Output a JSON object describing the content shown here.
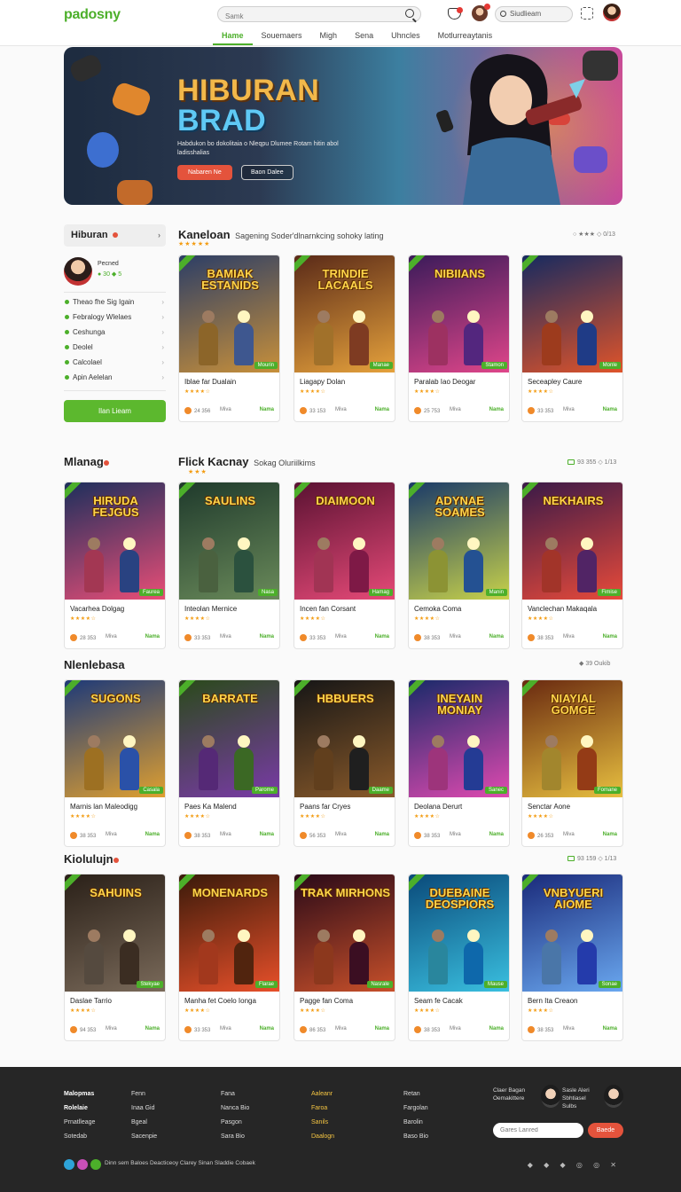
{
  "header": {
    "logo": "padosny",
    "search_placeholder": "Samk",
    "search2_placeholder": "Siudlieam",
    "nav": [
      "Hame",
      "Souemaers",
      "Migh",
      "Sena",
      "Uhncles",
      "Motlurreaytanis"
    ],
    "nav_active_index": 0,
    "colors": {
      "accent": "#4caf2a",
      "badge": "#e53935"
    }
  },
  "hero": {
    "title_line1": "HIBURAN",
    "title_line2": "BRAD",
    "subtitle": "Habdukon bo dokolitaia o Nleqpu Dlumee Rotam hitin abol ladisshalias",
    "primary_button": "Nabaren Ne",
    "secondary_button": "Baon Dalee"
  },
  "sidebar": {
    "title": "Hiburan",
    "profile_name": "Pecned",
    "profile_meta": "● 30 ◆ 5",
    "items": [
      {
        "label": "Theao fhe Sig Igain"
      },
      {
        "label": "Febralogy Wlelaes"
      },
      {
        "label": "Ceshunga"
      },
      {
        "label": "Deolel"
      },
      {
        "label": "Calcolael"
      },
      {
        "label": "Apin Aelelan"
      }
    ],
    "button": "Ilan Lieam"
  },
  "sections": [
    {
      "title": "Kaneloan",
      "subtitle": "Sagening Soder'dlnarnkcing sohoky lating",
      "meta": "○ ★★★ ◇ 0/13",
      "cards": [
        {
          "art_title": "BAMIAK ESTANIDS",
          "title": "Iblae far Dualain",
          "rating": "★★★★☆",
          "coins": "24 356",
          "mid": "Miva",
          "play": "Nama",
          "tag": "Mourin"
        },
        {
          "art_title": "TRINDIE LACAALS",
          "title": "Liagapy Dolan",
          "rating": "★★★★☆",
          "coins": "33 153",
          "mid": "Miva",
          "play": "Nama",
          "tag": "Manae"
        },
        {
          "art_title": "NIBIIANS",
          "title": "Paralab Iao Deogar",
          "rating": "★★★★☆",
          "coins": "25 753",
          "mid": "Miva",
          "play": "Nama",
          "tag": "Stamon"
        },
        {
          "art_title": "",
          "title": "Seceapley Caure",
          "rating": "★★★★☆",
          "coins": "33 353",
          "mid": "Miva",
          "play": "Nama",
          "tag": "Monle"
        }
      ]
    },
    {
      "title": "Mlanag",
      "subtitle": "",
      "meta": "93 355 ◇ 1/13",
      "second_title": "Flick Kacnay",
      "second_subtitle": "Sokag Oluriilkims",
      "cards": [
        {
          "art_title": "HIRUDA FEJGUS",
          "title": "Vacarhea Dolgag",
          "rating": "★★★★☆",
          "coins": "28 353",
          "mid": "Miva",
          "play": "Nama",
          "tag": "Faurea"
        },
        {
          "art_title": "SAULINS",
          "title": "Inteolan Mernice",
          "rating": "★★★★☆",
          "coins": "33 353",
          "mid": "Miva",
          "play": "Nama",
          "tag": "Nasa"
        },
        {
          "art_title": "DIAIMOON",
          "title": "Incen fan Corsant",
          "rating": "★★★★☆",
          "coins": "33 353",
          "mid": "Miva",
          "play": "Nama",
          "tag": "Hamag"
        },
        {
          "art_title": "ADYNAE SOAMES",
          "title": "Cemoka Coma",
          "rating": "★★★★☆",
          "coins": "38 353",
          "mid": "Miva",
          "play": "Nama",
          "tag": "Manin"
        },
        {
          "art_title": "NEKHAIRS",
          "title": "Vanclechan Makaqala",
          "rating": "★★★★☆",
          "coins": "38 353",
          "mid": "Miva",
          "play": "Nama",
          "tag": "Fimise"
        }
      ]
    },
    {
      "title": "Nlenlebasa",
      "subtitle": "",
      "meta": "◆ 39 Oukib",
      "cards": [
        {
          "art_title": "SUGONS",
          "title": "Marnis lan Maleodigg",
          "rating": "★★★★☆",
          "coins": "38 353",
          "mid": "Miva",
          "play": "Nama",
          "tag": "Casala"
        },
        {
          "art_title": "BARRATE",
          "title": "Paes Ka Malend",
          "rating": "★★★★☆",
          "coins": "38 353",
          "mid": "Miva",
          "play": "Nama",
          "tag": "Parome"
        },
        {
          "art_title": "HBBUERS",
          "title": "Paans far Cryes",
          "rating": "★★★★☆",
          "coins": "56 353",
          "mid": "Miva",
          "play": "Nama",
          "tag": "Daame"
        },
        {
          "art_title": "INEYAIN MONIAY",
          "title": "Deolana Derurt",
          "rating": "★★★★☆",
          "coins": "38 353",
          "mid": "Miva",
          "play": "Nama",
          "tag": "Sanec"
        },
        {
          "art_title": "NIAYIAL GOMGE",
          "title": "Senctar Aone",
          "rating": "★★★★☆",
          "coins": "26 353",
          "mid": "Miva",
          "play": "Nama",
          "tag": "Fomane"
        }
      ]
    },
    {
      "title": "Kiolulujn",
      "subtitle": "",
      "meta": "93 159 ◇ 1/13",
      "cards": [
        {
          "art_title": "SAHUINS",
          "title": "Daslae Tarrio",
          "rating": "★★★★☆",
          "coins": "94 353",
          "mid": "Miva",
          "play": "Nama",
          "tag": "Stekyae"
        },
        {
          "art_title": "MONENARDS",
          "title": "Manha fet Coelo Ionga",
          "rating": "★★★★☆",
          "coins": "33 353",
          "mid": "Miva",
          "play": "Nama",
          "tag": "Flarae"
        },
        {
          "art_title": "TRAK MIRHONS",
          "title": "Pagge fan Coma",
          "rating": "★★★★☆",
          "coins": "86 353",
          "mid": "Miva",
          "play": "Nama",
          "tag": "Nasrale"
        },
        {
          "art_title": "DUEBAINE DEOSPIORS",
          "title": "Seam fe Cacak",
          "rating": "★★★★☆",
          "coins": "38 353",
          "mid": "Miva",
          "play": "Nama",
          "tag": "Mause"
        },
        {
          "art_title": "VNBYUERI AIOME",
          "title": "Bern Ita Creaon",
          "rating": "★★★★☆",
          "coins": "38 353",
          "mid": "Miva",
          "play": "Nama",
          "tag": "Sonae"
        }
      ]
    }
  ],
  "footer": {
    "col1": [
      "Malopmas",
      "Rolelaie",
      "Prnatlleage",
      "Sotedab"
    ],
    "col2": [
      "Fenn",
      "Inaa Gid",
      "Bgeal",
      "Sacenpie"
    ],
    "col3": [
      "Fana",
      "Nanca Bio",
      "Pasgon",
      "Sara Bio"
    ],
    "col4": [
      "Aaleanr",
      "Faroa",
      "Sanils",
      "Daalogn"
    ],
    "col5": [
      "Retan",
      "Fargolan",
      "Barolin",
      "Baso Bio"
    ],
    "blurb": "Claer Bagan Oemakittere",
    "profile_text": "Sasle Aleri Sbhtiasel Sulbs",
    "newsletter_placeholder": "Gares Lanred",
    "newsletter_button": "Baede",
    "copyright": "Dinn sem Baloes Deacticeoy Clarey Sinan Sladdie Cobaek",
    "social_icons": "◆ ◆ ◆ ◎ ◎ ✕"
  }
}
